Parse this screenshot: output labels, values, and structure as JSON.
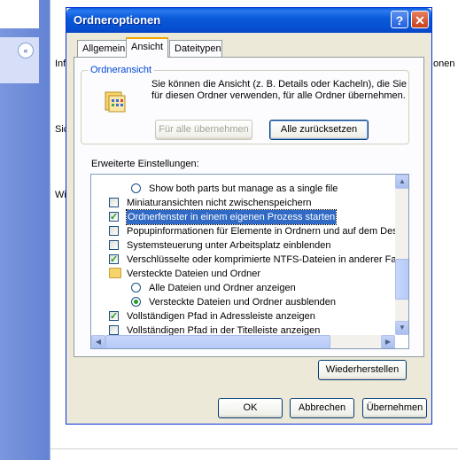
{
  "background": {
    "collapse_glyph": "«",
    "labels": [
      "Inf",
      "Sic",
      "Wi",
      "onen"
    ]
  },
  "dialog": {
    "title": "Ordneroptionen",
    "help_label": "?",
    "close_label": "✕",
    "tabs": [
      "Allgemein",
      "Ansicht",
      "Dateitypen"
    ],
    "active_tab": "Ansicht",
    "folder_view": {
      "group_label": "Ordneransicht",
      "description": "Sie können die Ansicht (z. B. Details oder Kacheln), die Sie für diesen Ordner verwenden, für alle Ordner übernehmen.",
      "apply_all_label": "Für alle übernehmen",
      "reset_all_label": "Alle zurücksetzen"
    },
    "advanced": {
      "label": "Erweiterte Einstellungen:",
      "items": [
        {
          "type": "radio",
          "checked": false,
          "text": "Show both parts but manage as a single file",
          "indent": 1
        },
        {
          "type": "checkbox",
          "checked": false,
          "text": "Miniaturansichten nicht zwischenspeichern",
          "indent": 0
        },
        {
          "type": "checkbox",
          "checked": true,
          "text": "Ordnerfenster in einem eigenen Prozess starten",
          "indent": 0,
          "selected": true
        },
        {
          "type": "checkbox",
          "checked": false,
          "text": "Popupinformationen für Elemente in Ordnern und auf dem Desk",
          "indent": 0
        },
        {
          "type": "checkbox",
          "checked": false,
          "text": "Systemsteuerung unter Arbeitsplatz einblenden",
          "indent": 0
        },
        {
          "type": "checkbox",
          "checked": true,
          "text": "Verschlüsselte oder komprimierte NTFS-Dateien in anderer Farb",
          "indent": 0
        },
        {
          "type": "folder",
          "checked": false,
          "text": "Versteckte Dateien und Ordner",
          "indent": 0
        },
        {
          "type": "radio",
          "checked": false,
          "text": "Alle Dateien und Ordner anzeigen",
          "indent": 1
        },
        {
          "type": "radio",
          "checked": true,
          "text": "Versteckte Dateien und Ordner ausblenden",
          "indent": 1
        },
        {
          "type": "checkbox",
          "checked": true,
          "text": "Vollständigen Pfad in Adressleiste anzeigen",
          "indent": 0
        },
        {
          "type": "checkbox",
          "checked": false,
          "text": "Vollständigen Pfad in der Titelleiste anzeigen",
          "indent": 0
        }
      ]
    },
    "restore_label": "Wiederherstellen",
    "ok_label": "OK",
    "cancel_label": "Abbrechen",
    "apply_label": "Übernehmen"
  },
  "colors": {
    "titlebar": "#0a5ddd",
    "dialog_face": "#ece9d8",
    "selection": "#316ac5",
    "check": "#21a121"
  }
}
